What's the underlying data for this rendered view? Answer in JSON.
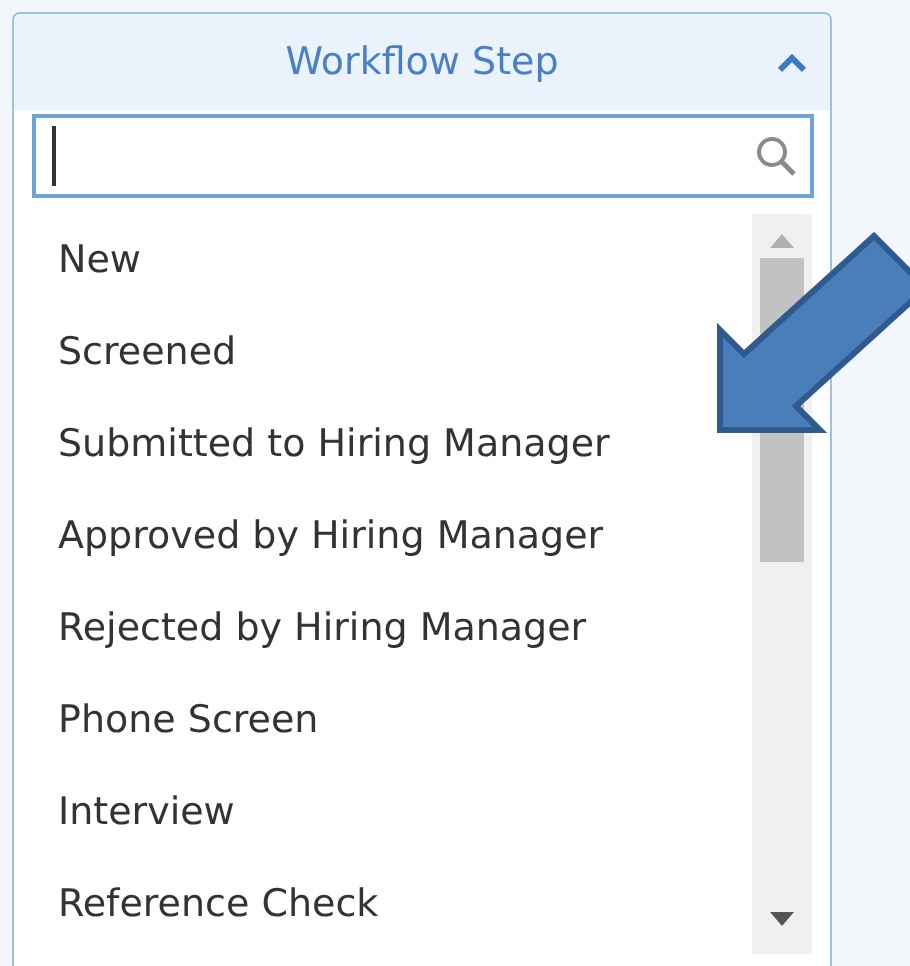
{
  "dropdown": {
    "title": "Workflow Step",
    "expanded": true,
    "options": [
      {
        "label": "New"
      },
      {
        "label": "Screened"
      },
      {
        "label": "Submitted to Hiring Manager"
      },
      {
        "label": "Approved by Hiring Manager"
      },
      {
        "label": "Rejected by Hiring Manager"
      },
      {
        "label": "Phone Screen"
      },
      {
        "label": "Interview"
      },
      {
        "label": "Reference Check"
      }
    ]
  }
}
